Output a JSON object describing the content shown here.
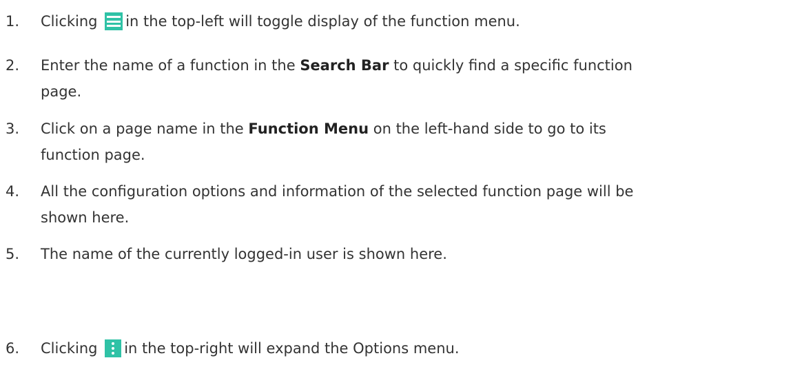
{
  "items": [
    {
      "number": "1.",
      "before": "Clicking",
      "icon": "hamburger-menu-icon",
      "after": "in the top-left will toggle display of the function menu."
    },
    {
      "number": "2.",
      "before": "Enter the name of a function in the",
      "bold": "Search Bar",
      "after": "to quickly find a specific function",
      "line2": "page."
    },
    {
      "number": "3.",
      "before": "Click on a page name in the",
      "bold": "Function Menu",
      "after": "on the left-hand side to go to its",
      "line2": "function page."
    },
    {
      "number": "4.",
      "text": "All the configuration options and information of the selected function page will be",
      "line2": "shown here."
    },
    {
      "number": "5.",
      "text": "The name of the currently logged-in user is shown here."
    },
    {
      "number": "6.",
      "before": "Clicking",
      "icon": "more-options-icon",
      "after": "in the top-right will expand the Options menu."
    }
  ],
  "colors": {
    "text": "#333333",
    "icon_accent": "#2fc2a6"
  }
}
